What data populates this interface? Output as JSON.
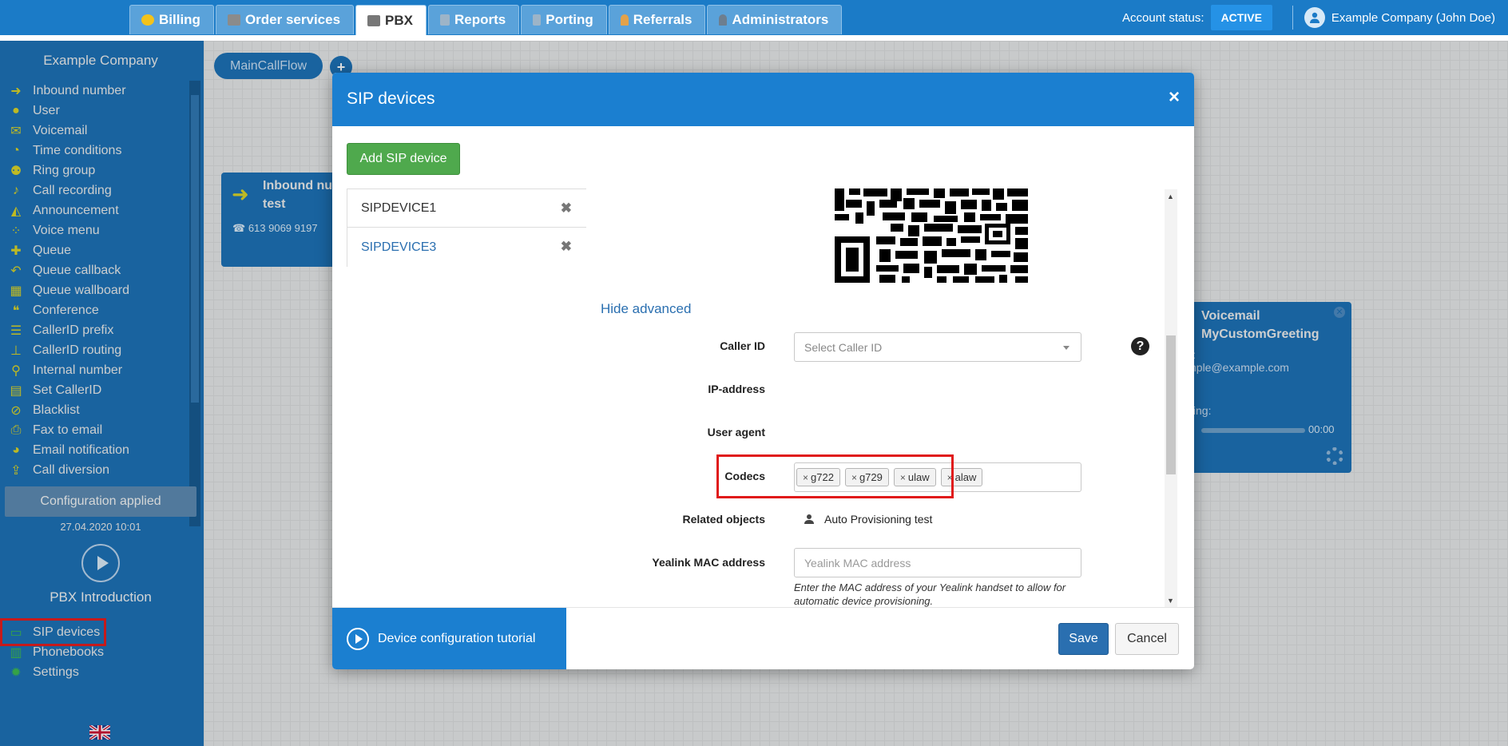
{
  "topbar": {
    "tabs": [
      {
        "label": "Billing",
        "icon": "coins-icon"
      },
      {
        "label": "Order services",
        "icon": "cart-icon"
      },
      {
        "label": "PBX",
        "icon": "pbx-icon"
      },
      {
        "label": "Reports",
        "icon": "report-icon"
      },
      {
        "label": "Porting",
        "icon": "phone-icon"
      },
      {
        "label": "Referrals",
        "icon": "person-icon"
      },
      {
        "label": "Administrators",
        "icon": "admin-icon"
      }
    ],
    "active_tab": "PBX",
    "account_status_label": "Account status:",
    "account_status_value": "ACTIVE",
    "company_user": "Example Company (John Doe)"
  },
  "sidebar": {
    "company": "Example Company",
    "items": [
      {
        "label": "Inbound number",
        "icon": "arrow-right-icon"
      },
      {
        "label": "User",
        "icon": "user-icon"
      },
      {
        "label": "Voicemail",
        "icon": "envelope-icon"
      },
      {
        "label": "Time conditions",
        "icon": "clock-icon"
      },
      {
        "label": "Ring group",
        "icon": "group-icon"
      },
      {
        "label": "Call recording",
        "icon": "microphone-icon"
      },
      {
        "label": "Announcement",
        "icon": "megaphone-icon"
      },
      {
        "label": "Voice menu",
        "icon": "grid-icon"
      },
      {
        "label": "Queue",
        "icon": "queue-icon"
      },
      {
        "label": "Queue callback",
        "icon": "reply-icon"
      },
      {
        "label": "Queue wallboard",
        "icon": "table-icon"
      },
      {
        "label": "Conference",
        "icon": "chat-icon"
      },
      {
        "label": "CallerID prefix",
        "icon": "list-icon"
      },
      {
        "label": "CallerID routing",
        "icon": "sitemap-icon"
      },
      {
        "label": "Internal number",
        "icon": "map-pin-icon"
      },
      {
        "label": "Set CallerID",
        "icon": "id-card-icon"
      },
      {
        "label": "Blacklist",
        "icon": "ban-icon"
      },
      {
        "label": "Fax to email",
        "icon": "printer-icon"
      },
      {
        "label": "Email notification",
        "icon": "bell-icon"
      },
      {
        "label": "Call diversion",
        "icon": "upload-icon"
      }
    ],
    "config_status": "Configuration applied",
    "config_date": "27.04.2020 10:01",
    "intro_label": "PBX Introduction",
    "bottom_items": [
      {
        "label": "SIP devices",
        "icon": "monitor-icon"
      },
      {
        "label": "Phonebooks",
        "icon": "book-icon"
      },
      {
        "label": "Settings",
        "icon": "gear-icon"
      }
    ]
  },
  "canvas": {
    "flow_name": "MainCallFlow",
    "inbound_node": {
      "title_line1": "Inbound nu",
      "title_line2": "test",
      "phone": "613 9069 9197"
    },
    "voicemail_node": {
      "title_line1": "Voicemail",
      "title_line2": "MyCustomGreeting",
      "email_fragment": "l:",
      "email": "nple@example.com",
      "greeting_label": "ting:",
      "time": "00:00"
    }
  },
  "modal": {
    "title": "SIP devices",
    "add_button": "Add SIP device",
    "devices": [
      {
        "name": "SIPDEVICE1",
        "selected": false
      },
      {
        "name": "SIPDEVICE3",
        "selected": true
      }
    ],
    "hide_advanced": "Hide advanced",
    "fields": {
      "caller_id_label": "Caller ID",
      "caller_id_placeholder": "Select Caller ID",
      "ip_label": "IP-address",
      "user_agent_label": "User agent",
      "codecs_label": "Codecs",
      "codecs": [
        "g722",
        "g729",
        "ulaw",
        "alaw"
      ],
      "related_label": "Related objects",
      "related_value": "Auto Provisioning test",
      "mac_label": "Yealink MAC address",
      "mac_placeholder": "Yealink MAC address",
      "mac_help": "Enter the MAC address of your Yealink handset to allow for automatic device provisioning."
    },
    "tutorial_label": "Device configuration tutorial",
    "save_label": "Save",
    "cancel_label": "Cancel"
  },
  "colors": {
    "brand_blue": "#1b7bc7",
    "sidebar_blue": "#1b6db0",
    "icon_yellow": "#d6cf23",
    "add_green": "#4fa94d",
    "highlight_red": "#e01a1a"
  }
}
